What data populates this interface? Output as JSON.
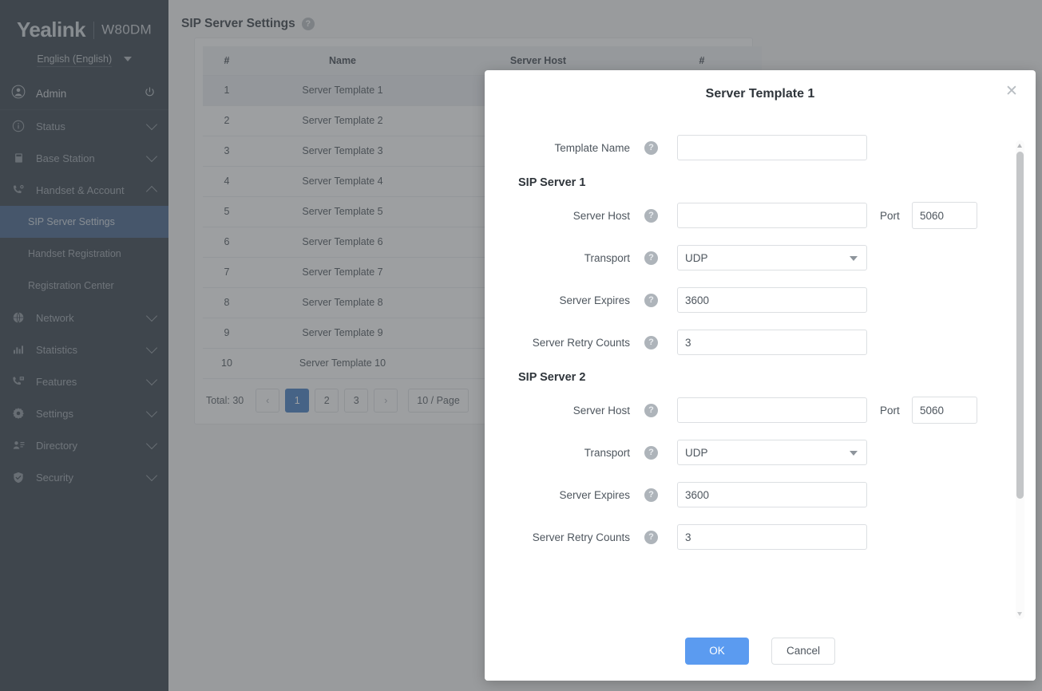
{
  "brand": {
    "name": "Yealink",
    "model": "W80DM",
    "language": "English (English)"
  },
  "sidebar": {
    "admin_label": "Admin",
    "power_icon": "power-icon",
    "items": [
      {
        "label": "Status",
        "icon": "info-circle-icon",
        "expanded": false
      },
      {
        "label": "Base Station",
        "icon": "base-station-icon",
        "expanded": false
      },
      {
        "label": "Handset & Account",
        "icon": "handset-icon",
        "expanded": true
      },
      {
        "label": "Network",
        "icon": "globe-icon",
        "expanded": false
      },
      {
        "label": "Statistics",
        "icon": "bar-chart-icon",
        "expanded": false
      },
      {
        "label": "Features",
        "icon": "phone-feature-icon",
        "expanded": false
      },
      {
        "label": "Settings",
        "icon": "gear-icon",
        "expanded": false
      },
      {
        "label": "Directory",
        "icon": "contact-card-icon",
        "expanded": false
      },
      {
        "label": "Security",
        "icon": "shield-icon",
        "expanded": false
      }
    ],
    "subitems": [
      {
        "label": "SIP Server Settings",
        "active": true
      },
      {
        "label": "Handset Registration",
        "active": false
      },
      {
        "label": "Registration Center",
        "active": false
      }
    ]
  },
  "page": {
    "title": "SIP Server Settings",
    "help_icon": "help-circle-icon"
  },
  "table": {
    "columns": [
      "#",
      "Name",
      "Server Host",
      "#"
    ],
    "rows": [
      {
        "idx": "1",
        "name": "Server Template 1",
        "host": "",
        "extra": "",
        "selected": true
      },
      {
        "idx": "2",
        "name": "Server Template 2",
        "host": "",
        "extra": "",
        "selected": false
      },
      {
        "idx": "3",
        "name": "Server Template 3",
        "host": "",
        "extra": "",
        "selected": false
      },
      {
        "idx": "4",
        "name": "Server Template 4",
        "host": "",
        "extra": "",
        "selected": false
      },
      {
        "idx": "5",
        "name": "Server Template 5",
        "host": "",
        "extra": "",
        "selected": false
      },
      {
        "idx": "6",
        "name": "Server Template 6",
        "host": "",
        "extra": "",
        "selected": false
      },
      {
        "idx": "7",
        "name": "Server Template 7",
        "host": "",
        "extra": "",
        "selected": false
      },
      {
        "idx": "8",
        "name": "Server Template 8",
        "host": "",
        "extra": "",
        "selected": false
      },
      {
        "idx": "9",
        "name": "Server Template 9",
        "host": "",
        "extra": "",
        "selected": false
      },
      {
        "idx": "10",
        "name": "Server Template 10",
        "host": "",
        "extra": "",
        "selected": false
      }
    ]
  },
  "pagination": {
    "total_label": "Total: 30",
    "prev": "‹",
    "next": "›",
    "pages": [
      "1",
      "2",
      "3"
    ],
    "current_page": "1",
    "page_size": "10 / Page"
  },
  "modal": {
    "title": "Server Template 1",
    "close_icon": "close-icon",
    "template_name": {
      "label": "Template Name",
      "value": "",
      "help_icon": "help-circle-icon"
    },
    "sections": [
      {
        "title": "SIP Server 1",
        "fields": {
          "server_host": {
            "label": "Server Host",
            "value": "",
            "help_icon": "help-circle-icon"
          },
          "port": {
            "label": "Port",
            "value": "5060"
          },
          "transport": {
            "label": "Transport",
            "value": "UDP",
            "help_icon": "help-circle-icon",
            "arrow_icon": "chevron-down-icon"
          },
          "expires": {
            "label": "Server Expires",
            "value": "3600",
            "help_icon": "help-circle-icon"
          },
          "retry_counts": {
            "label": "Server Retry Counts",
            "value": "3",
            "help_icon": "help-circle-icon"
          }
        }
      },
      {
        "title": "SIP Server 2",
        "fields": {
          "server_host": {
            "label": "Server Host",
            "value": "",
            "help_icon": "help-circle-icon"
          },
          "port": {
            "label": "Port",
            "value": "5060"
          },
          "transport": {
            "label": "Transport",
            "value": "UDP",
            "help_icon": "help-circle-icon",
            "arrow_icon": "chevron-down-icon"
          },
          "expires": {
            "label": "Server Expires",
            "value": "3600",
            "help_icon": "help-circle-icon"
          },
          "retry_counts": {
            "label": "Server Retry Counts",
            "value": "3",
            "help_icon": "help-circle-icon"
          }
        }
      }
    ],
    "footer": {
      "ok_label": "OK",
      "cancel_label": "Cancel"
    },
    "scrollbar": {
      "up_icon": "scroll-up-arrow-icon",
      "down_icon": "scroll-down-arrow-icon"
    }
  },
  "colors": {
    "sidebar_bg": "#2f3a45",
    "sidebar_active": "#3f5e87",
    "accent_blue": "#5b9bf0",
    "pager_active": "#3f7ac4",
    "overlay": "rgba(77,80,83,0.55)"
  }
}
